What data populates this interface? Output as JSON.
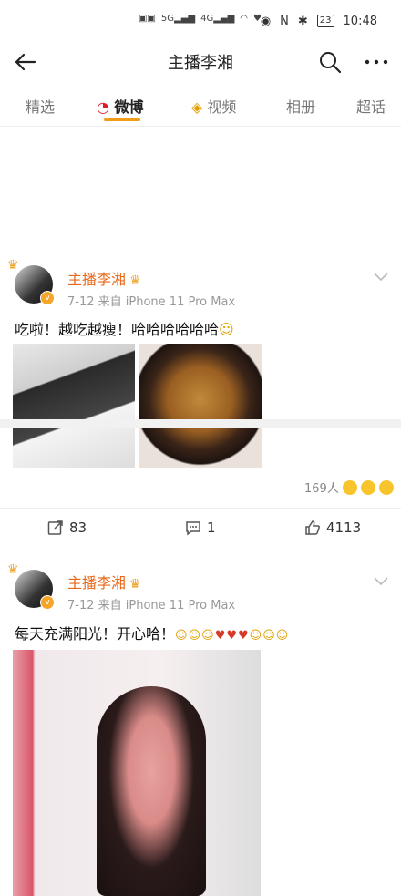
{
  "status": {
    "time": "10:48",
    "battery": "23"
  },
  "nav": {
    "title": "主播李湘"
  },
  "tabs": [
    {
      "label": "精选"
    },
    {
      "label": "微博"
    },
    {
      "label": "视频"
    },
    {
      "label": "相册"
    },
    {
      "label": "超话"
    }
  ],
  "posts": [
    {
      "author": "主播李湘",
      "date": "7-12",
      "source": "来自 iPhone 11 Pro Max",
      "text": "吃啦！越吃越瘦！哈哈哈哈哈哈",
      "reaction_count": "169人",
      "reposts": "83",
      "comments": "1",
      "likes": "4113"
    },
    {
      "author": "主播李湘",
      "date": "7-12",
      "source": "来自 iPhone 11 Pro Max",
      "text": "每天充满阳光！开心哈！"
    }
  ]
}
